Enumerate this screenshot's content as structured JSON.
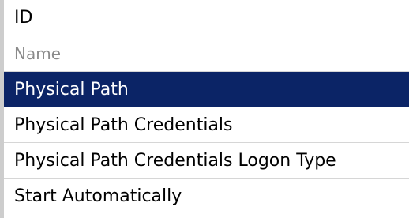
{
  "property_list": {
    "items": [
      {
        "label": "ID",
        "state": "normal"
      },
      {
        "label": "Name",
        "state": "disabled"
      },
      {
        "label": "Physical Path",
        "state": "selected"
      },
      {
        "label": "Physical Path Credentials",
        "state": "normal"
      },
      {
        "label": "Physical Path Credentials Logon Type",
        "state": "normal"
      },
      {
        "label": "Start Automatically",
        "state": "normal"
      }
    ]
  },
  "colors": {
    "selection_background": "#0b2466",
    "selection_text": "#ffffff",
    "disabled_text": "#8a8a8a",
    "row_separator": "#d6d6d6",
    "left_border": "#cdcdcd"
  }
}
